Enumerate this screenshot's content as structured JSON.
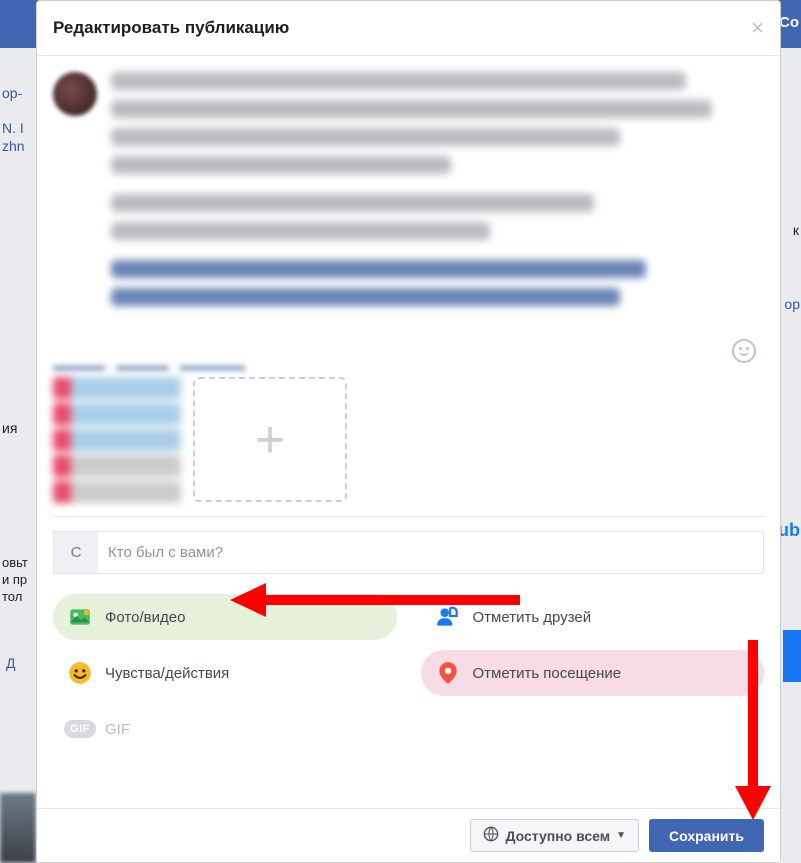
{
  "dialog": {
    "title": "Редактировать публикацию",
    "close": "×"
  },
  "tag_people": {
    "prefix": "С",
    "placeholder": "Кто был с вами?"
  },
  "options": {
    "photo_video": "Фото/видео",
    "tag_friends": "Отметить друзей",
    "feeling": "Чувства/действия",
    "check_in": "Отметить посещение",
    "gif": "GIF"
  },
  "footer": {
    "privacy": "Доступно всем",
    "save": "Сохранить"
  },
  "bg": {
    "frag1": "ор-",
    "frag2": "N. I",
    "frag3": "zhn",
    "frag4": "ия",
    "frag5": "к",
    "frag6": "ор",
    "frag7": "ub",
    "frag8": "Д",
    "frag9": "Co",
    "trunc1": "овьт",
    "trunc2": "и пр",
    "trunc3": "тол"
  }
}
